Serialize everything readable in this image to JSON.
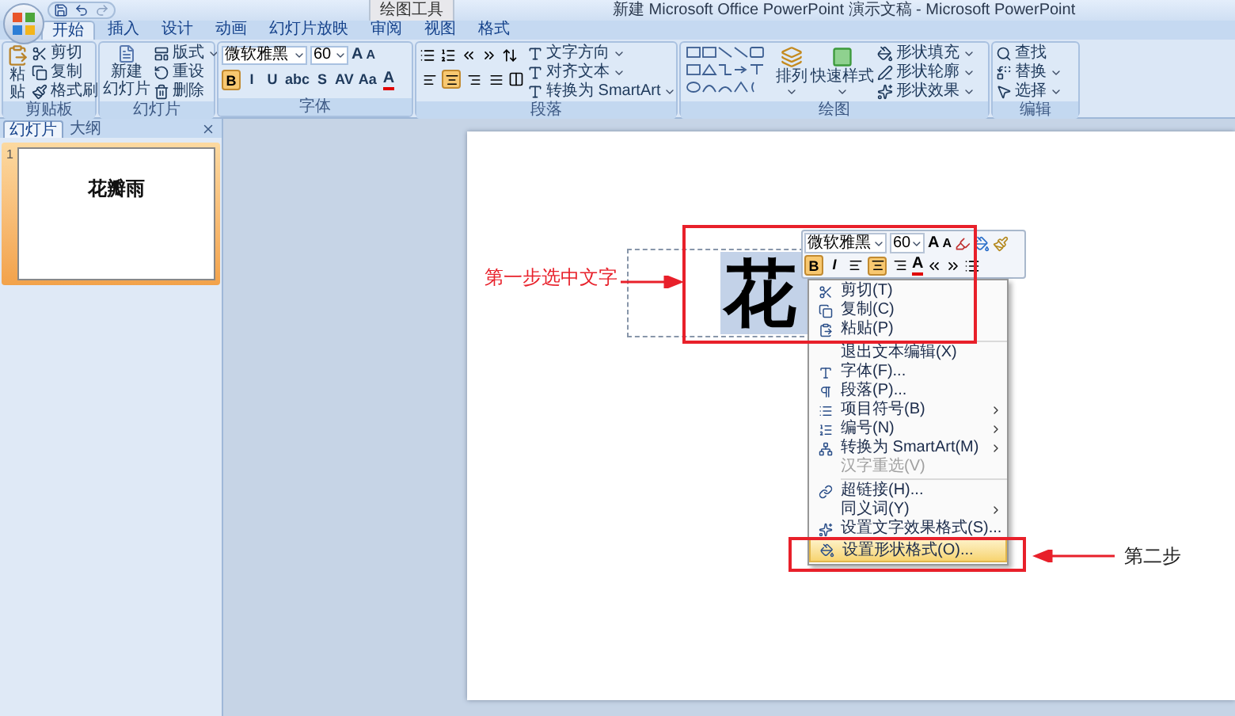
{
  "title_bar": {
    "contextual_tab": "绘图工具",
    "title": "新建 Microsoft Office PowerPoint 演示文稿 - Microsoft PowerPoint"
  },
  "tabs": [
    {
      "label": "开始",
      "selected": true
    },
    {
      "label": "插入",
      "selected": false
    },
    {
      "label": "设计",
      "selected": false
    },
    {
      "label": "动画",
      "selected": false
    },
    {
      "label": "幻灯片放映",
      "selected": false
    },
    {
      "label": "审阅",
      "selected": false
    },
    {
      "label": "视图",
      "selected": false
    },
    {
      "label": "格式",
      "selected": false
    }
  ],
  "ribbon": {
    "clipboard": {
      "label": "剪贴板",
      "paste": "粘贴",
      "items": [
        "剪切",
        "复制",
        "格式刷"
      ]
    },
    "slides": {
      "label": "幻灯片",
      "new_slide": [
        "新建",
        "幻灯片"
      ],
      "items": [
        "版式",
        "重设",
        "删除"
      ]
    },
    "font": {
      "label": "字体",
      "font_name": "微软雅黑",
      "font_size": "60",
      "grow": "A",
      "shrink": "A",
      "font_color": "A",
      "buttons": [
        {
          "label": "B",
          "selected": true
        },
        {
          "label": "I",
          "selected": false
        },
        {
          "label": "U",
          "selected": false
        },
        {
          "label": "abc",
          "selected": false
        },
        {
          "label": "S",
          "selected": false
        },
        {
          "label": "AV",
          "selected": false
        },
        {
          "label": "Aa",
          "selected": false
        }
      ]
    },
    "paragraph": {
      "label": "段落",
      "items": [
        "文字方向",
        "对齐文本",
        "转换为 SmartArt"
      ],
      "alignment": [
        {
          "selected": false
        },
        {
          "selected": true
        },
        {
          "selected": false
        },
        {
          "selected": false
        }
      ]
    },
    "drawing": {
      "label": "绘图",
      "arrange": "排列",
      "quick_styles": "快速样式",
      "items": [
        "形状填充",
        "形状轮廓",
        "形状效果"
      ]
    },
    "editing": {
      "label": "编辑",
      "items": [
        "查找",
        "替换",
        "选择"
      ]
    }
  },
  "panel": {
    "tabs": [
      {
        "label": "幻灯片",
        "selected": true
      },
      {
        "label": "大纲",
        "selected": false
      }
    ],
    "slides": [
      {
        "number": "1",
        "title": "花瓣雨",
        "selected": true
      }
    ]
  },
  "slide": {
    "text": "花"
  },
  "mini_toolbar": {
    "font_name": "微软雅黑",
    "font_size": "60",
    "grow": "A",
    "shrink": "A",
    "font_color": "A",
    "bold": {
      "label": "B",
      "selected": true
    },
    "italic": {
      "label": "I",
      "selected": false
    },
    "alignment": [
      {
        "selected": false
      },
      {
        "selected": true
      },
      {
        "selected": false
      }
    ]
  },
  "context_menu": [
    {
      "kind": "item",
      "label": "剪切(T)",
      "disabled": false,
      "submenu": false,
      "selected": false
    },
    {
      "kind": "item",
      "label": "复制(C)",
      "disabled": false,
      "submenu": false,
      "selected": false
    },
    {
      "kind": "item",
      "label": "粘贴(P)",
      "disabled": false,
      "submenu": false,
      "selected": false
    },
    {
      "kind": "separator"
    },
    {
      "kind": "item",
      "label": "退出文本编辑(X)",
      "disabled": false,
      "submenu": false,
      "selected": false
    },
    {
      "kind": "item",
      "label": "字体(F)...",
      "disabled": false,
      "submenu": false,
      "selected": false
    },
    {
      "kind": "item",
      "label": "段落(P)...",
      "disabled": false,
      "submenu": false,
      "selected": false
    },
    {
      "kind": "item",
      "label": "项目符号(B)",
      "disabled": false,
      "submenu": true,
      "selected": false
    },
    {
      "kind": "item",
      "label": "编号(N)",
      "disabled": false,
      "submenu": true,
      "selected": false
    },
    {
      "kind": "item",
      "label": "转换为 SmartArt(M)",
      "disabled": false,
      "submenu": true,
      "selected": false
    },
    {
      "kind": "item",
      "label": "汉字重选(V)",
      "disabled": true,
      "submenu": false,
      "selected": false
    },
    {
      "kind": "separator"
    },
    {
      "kind": "item",
      "label": "超链接(H)...",
      "disabled": false,
      "submenu": false,
      "selected": false
    },
    {
      "kind": "item",
      "label": "同义词(Y)",
      "disabled": false,
      "submenu": true,
      "selected": false
    },
    {
      "kind": "item",
      "label": "设置文字效果格式(S)...",
      "disabled": false,
      "submenu": false,
      "selected": false
    },
    {
      "kind": "item",
      "label": "设置形状格式(O)...",
      "disabled": false,
      "submenu": false,
      "selected": true
    }
  ],
  "annotations": {
    "step1": "第一步选中文字",
    "step2": "第二步"
  }
}
